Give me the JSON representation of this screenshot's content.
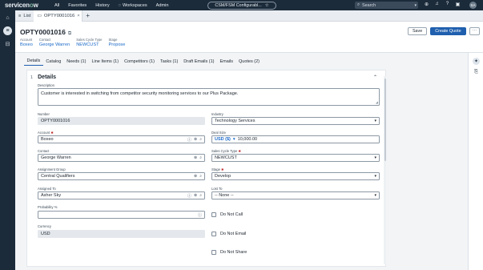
{
  "nav": {
    "logo_a": "servicen",
    "logo_o": "o",
    "logo_b": "w",
    "menu": [
      "All",
      "Favorites",
      "History",
      "Workspaces",
      "Admin"
    ],
    "center_title": "CSM/FSM Configurabl...",
    "star": "☆",
    "search_placeholder": "Search",
    "avatar_initials": "SA"
  },
  "tabs": {
    "list_label": "List",
    "record_label": "OPTY0001016",
    "close": "×",
    "add": "+"
  },
  "header": {
    "number": "OPTY0001016",
    "fields": [
      {
        "label": "Account",
        "value": "Boxeo"
      },
      {
        "label": "Contact",
        "value": "George Warren"
      },
      {
        "label": "Sales Cycle Type",
        "value": "NEWCUST"
      },
      {
        "label": "Stage",
        "value": "Propose"
      }
    ],
    "save": "Save",
    "create_quote": "Create Quote",
    "more": "⋯"
  },
  "subtabs": [
    "Details",
    "Catalog",
    "Needs (1)",
    "Line Items (1)",
    "Competitors (1)",
    "Tasks (1)",
    "Draft Emails (1)",
    "Emails",
    "Quotes (2)"
  ],
  "section": {
    "num": "1",
    "title": "Details"
  },
  "form": {
    "description_label": "Description",
    "description_value": "Customer is interested in switching from competitor security monitoring services to our Plus Package.",
    "number_label": "Number",
    "number_value": "OPTY0001016",
    "industry_label": "Industry",
    "industry_value": "Technology Services",
    "account_label": "Account",
    "account_value": "Boxeo",
    "deal_size_label": "Deal Size",
    "deal_currency": "USD ($)",
    "deal_value": "10,000.00",
    "contact_label": "Contact",
    "contact_value": "George Warren",
    "sales_cycle_label": "Sales Cycle Type",
    "sales_cycle_value": "NEWCUST",
    "assignment_label": "Assignment Group",
    "assignment_value": "Central Qualifiers",
    "stage_label": "Stage",
    "stage_value": "Develop",
    "assigned_label": "Assigned To",
    "assigned_value": "Asher Sky",
    "lost_label": "Lost To",
    "lost_value": "-- None --",
    "probability_label": "Probability %",
    "probability_value": "",
    "currency_label": "Currency",
    "currency_value": "USD",
    "do_not_call": "Do Not Call",
    "do_not_email": "Do Not Email",
    "do_not_share": "Do Not Share",
    "required_mark": "✱"
  },
  "icons": {
    "globe": "globe-icon",
    "bell": "bell-icon",
    "help": "help-icon",
    "chat": "chat-icon"
  },
  "colors": {
    "nav_bg": "#1c2b3a",
    "primary": "#1f5fae",
    "link": "#1b6ac9"
  }
}
